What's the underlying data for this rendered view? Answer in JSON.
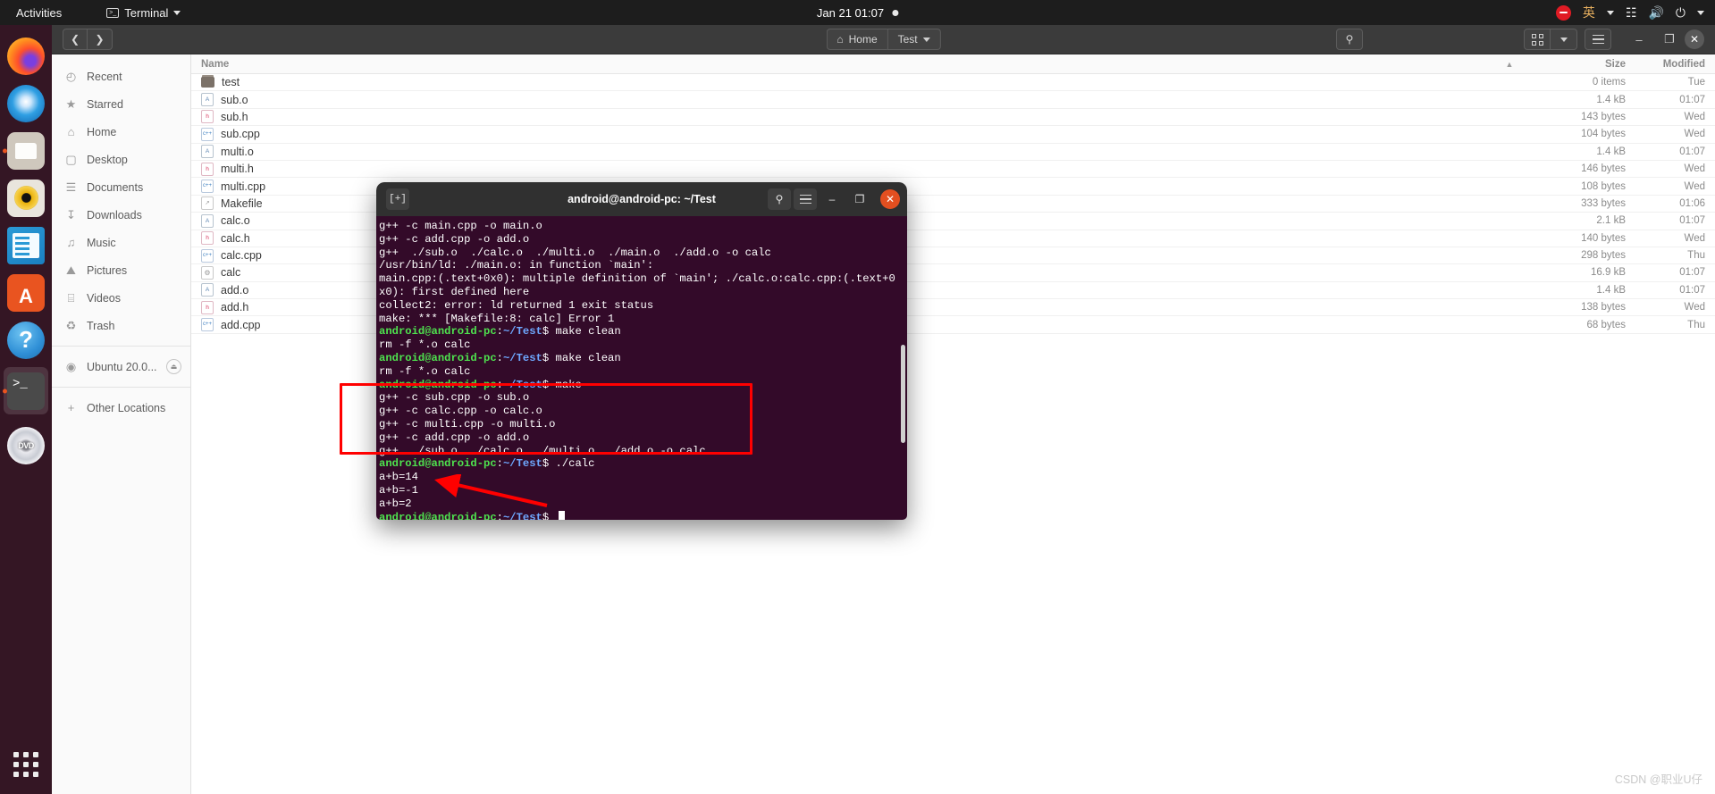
{
  "topbar": {
    "activities": "Activities",
    "app_name": "Terminal",
    "app_icon": "terminal-icon",
    "clock": "Jan 21  01:07",
    "indicators": {
      "recording": "recording-indicator",
      "input_method": "英",
      "network": "network-icon",
      "volume": "volume-icon",
      "power": "power-icon"
    }
  },
  "dock": {
    "items": [
      {
        "name": "firefox",
        "label": "Firefox",
        "running": false
      },
      {
        "name": "thunderbird",
        "label": "Thunderbird",
        "running": false
      },
      {
        "name": "files",
        "label": "Files",
        "running": true
      },
      {
        "name": "rhythmbox",
        "label": "Rhythmbox",
        "running": false
      },
      {
        "name": "libreoffice-writer",
        "label": "LibreOffice Writer",
        "running": false
      },
      {
        "name": "ubuntu-software",
        "label": "Ubuntu Software",
        "running": false
      },
      {
        "name": "help",
        "label": "Help",
        "running": false
      },
      {
        "name": "terminal",
        "label": "Terminal",
        "running": true
      },
      {
        "name": "dvd",
        "label": "DVD",
        "running": false
      }
    ],
    "show_apps_label": "Show Applications"
  },
  "nautilus": {
    "header": {
      "back_label": "❮",
      "forward_label": "❯",
      "path_home": "Home",
      "path_current": "Test",
      "search_icon": "search-icon",
      "view_icon": "grid-view-icon",
      "view_dropdown_icon": "chevron-down-icon",
      "menu_icon": "hamburger-menu-icon",
      "minimize_label": "–",
      "maximize_label": "❐",
      "close_label": "✕"
    },
    "sidebar": [
      {
        "label": "Recent",
        "icon": "clock-icon"
      },
      {
        "label": "Starred",
        "icon": "star-icon"
      },
      {
        "label": "Home",
        "icon": "home-icon"
      },
      {
        "label": "Desktop",
        "icon": "desktop-icon"
      },
      {
        "label": "Documents",
        "icon": "document-icon"
      },
      {
        "label": "Downloads",
        "icon": "download-icon"
      },
      {
        "label": "Music",
        "icon": "music-note-icon"
      },
      {
        "label": "Pictures",
        "icon": "picture-icon"
      },
      {
        "label": "Videos",
        "icon": "film-icon"
      },
      {
        "label": "Trash",
        "icon": "trash-icon"
      }
    ],
    "sidebar_devices": [
      {
        "label": "Ubuntu 20.0...",
        "icon": "disc-icon",
        "eject": "eject-icon"
      }
    ],
    "sidebar_other": {
      "label": "Other Locations",
      "icon": "plus-icon"
    },
    "columns": {
      "name": "Name",
      "size": "Size",
      "modified": "Modified",
      "sort_indicator": "▲"
    },
    "files": [
      {
        "name": "test",
        "type": "folder",
        "badge": "",
        "size": "0 items",
        "modified": "Tue"
      },
      {
        "name": "sub.o",
        "type": "obj",
        "badge": "A",
        "size": "1.4 kB",
        "modified": "01:07"
      },
      {
        "name": "sub.h",
        "type": "h",
        "badge": "h",
        "size": "143 bytes",
        "modified": "Wed"
      },
      {
        "name": "sub.cpp",
        "type": "cpp",
        "badge": "c++",
        "size": "104 bytes",
        "modified": "Wed"
      },
      {
        "name": "multi.o",
        "type": "obj",
        "badge": "A",
        "size": "1.4 kB",
        "modified": "01:07"
      },
      {
        "name": "multi.h",
        "type": "h",
        "badge": "h",
        "size": "146 bytes",
        "modified": "Wed"
      },
      {
        "name": "multi.cpp",
        "type": "cpp",
        "badge": "c++",
        "size": "108 bytes",
        "modified": "Wed"
      },
      {
        "name": "Makefile",
        "type": "mk",
        "badge": "↗",
        "size": "333 bytes",
        "modified": "01:06"
      },
      {
        "name": "calc.o",
        "type": "obj",
        "badge": "A",
        "size": "2.1 kB",
        "modified": "01:07"
      },
      {
        "name": "calc.h",
        "type": "h",
        "badge": "h",
        "size": "140 bytes",
        "modified": "Wed"
      },
      {
        "name": "calc.cpp",
        "type": "cpp",
        "badge": "c++",
        "size": "298 bytes",
        "modified": "Thu"
      },
      {
        "name": "calc",
        "type": "bin",
        "badge": "⚙",
        "size": "16.9 kB",
        "modified": "01:07"
      },
      {
        "name": "add.o",
        "type": "obj",
        "badge": "A",
        "size": "1.4 kB",
        "modified": "01:07"
      },
      {
        "name": "add.h",
        "type": "h",
        "badge": "h",
        "size": "138 bytes",
        "modified": "Wed"
      },
      {
        "name": "add.cpp",
        "type": "cpp",
        "badge": "c++",
        "size": "68 bytes",
        "modified": "Thu"
      }
    ]
  },
  "terminal": {
    "title": "android@android-pc: ~/Test",
    "new_tab_icon": "new-tab-icon",
    "search_icon": "search-icon",
    "menu_icon": "hamburger-menu-icon",
    "minimize_label": "–",
    "maximize_label": "❐",
    "close_label": "✕",
    "prompt": {
      "user": "android@android-pc",
      "colon": ":",
      "path": "~/Test",
      "sign": "$"
    },
    "lines": [
      {
        "kind": "out",
        "text": "g++ -c main.cpp -o main.o"
      },
      {
        "kind": "out",
        "text": "g++ -c add.cpp -o add.o"
      },
      {
        "kind": "out",
        "text": "g++  ./sub.o  ./calc.o  ./multi.o  ./main.o  ./add.o -o calc"
      },
      {
        "kind": "out",
        "text": "/usr/bin/ld: ./main.o: in function `main':"
      },
      {
        "kind": "out",
        "text": "main.cpp:(.text+0x0): multiple definition of `main'; ./calc.o:calc.cpp:(.text+0"
      },
      {
        "kind": "out",
        "text": "x0): first defined here"
      },
      {
        "kind": "out",
        "text": "collect2: error: ld returned 1 exit status"
      },
      {
        "kind": "out",
        "text": "make: *** [Makefile:8: calc] Error 1"
      },
      {
        "kind": "prompt",
        "text": " make clean"
      },
      {
        "kind": "out",
        "text": "rm -f *.o calc"
      },
      {
        "kind": "prompt",
        "text": " make clean"
      },
      {
        "kind": "out",
        "text": "rm -f *.o calc"
      },
      {
        "kind": "prompt",
        "text": " make"
      },
      {
        "kind": "out",
        "text": "g++ -c sub.cpp -o sub.o"
      },
      {
        "kind": "out",
        "text": "g++ -c calc.cpp -o calc.o"
      },
      {
        "kind": "out",
        "text": "g++ -c multi.cpp -o multi.o"
      },
      {
        "kind": "out",
        "text": "g++ -c add.cpp -o add.o"
      },
      {
        "kind": "out",
        "text": "g++  ./sub.o  ./calc.o  ./multi.o  ./add.o -o calc"
      },
      {
        "kind": "prompt",
        "text": " ./calc"
      },
      {
        "kind": "out",
        "text": "a+b=14"
      },
      {
        "kind": "out",
        "text": "a+b=-1"
      },
      {
        "kind": "out",
        "text": "a+b=2"
      },
      {
        "kind": "prompt-cursor",
        "text": " "
      }
    ]
  },
  "annotations": {
    "highlight_box_color": "#ff0000",
    "arrow_color": "#ff0000"
  },
  "watermark": "CSDN @职业U仔"
}
